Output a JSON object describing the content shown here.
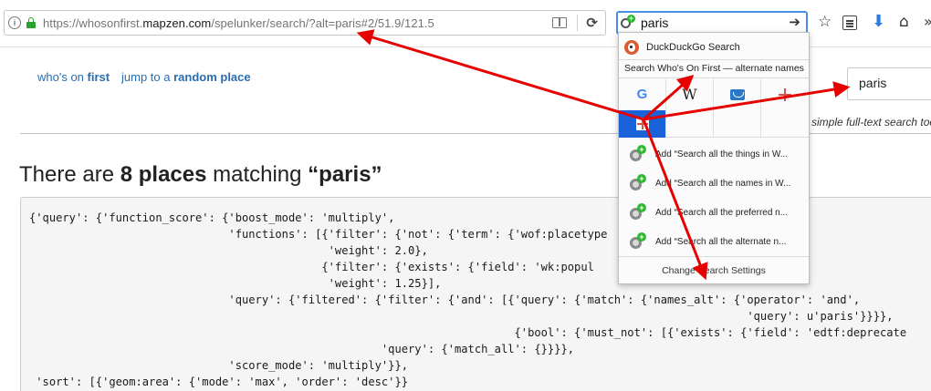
{
  "browser": {
    "url_prefix": "https://whosonfirst.",
    "url_host": "mapzen.com",
    "url_rest": "/spelunker/search/?alt=paris#2/51.9/121.5",
    "search_value": "paris",
    "info_icon": "info-icon",
    "lock_icon": "lock-icon",
    "reader_icon": "reader-view-icon",
    "reload_icon": "reload-icon",
    "search_go_icon": "arrow-right-icon",
    "toolbar_icons": [
      "star-icon",
      "clipboard-icon",
      "download-icon",
      "home-icon",
      "overflow-icon"
    ],
    "accent_color": "#4a90e2"
  },
  "search_popup": {
    "engine_top_label": "DuckDuckGo Search",
    "search_title_prefix": "Search ",
    "search_title_site": "Who's On First",
    "search_title_suffix": " — alternate names",
    "engines": [
      "G",
      "W"
    ],
    "engine_icons": [
      "google-icon",
      "wikipedia-icon",
      "book-icon",
      "compass-icon"
    ],
    "selected_engine_icon": "wof-icon",
    "add_items": [
      "Add “Search all the things in W...",
      "Add “Search all the names in W...",
      "Add “Search all the preferred n...",
      "Add “Search all the alternate n..."
    ],
    "footer": "Change Search Settings",
    "selected_color": "#1a62d8"
  },
  "page": {
    "brand_prefix": "who's on ",
    "brand_bold": "first",
    "random_prefix": "jump to a ",
    "random_bold": "random place",
    "search_value": "paris",
    "hint": "simple full-text search tool",
    "heading_prefix": "There are ",
    "heading_count": "8 places",
    "heading_mid": " matching ",
    "heading_query": "“paris”",
    "link_color": "#2b6cb0"
  },
  "code_lines": [
    "{'query': {'function_score': {'boost_mode': 'multiply',",
    "                              'functions': [{'filter': {'not': {'term': {'wof:placetype",
    "                                             'weight': 2.0},",
    "                                            {'filter': {'exists': {'field': 'wk:popul",
    "                                             'weight': 1.25}],",
    "                              'query': {'filtered': {'filter': {'and': [{'query': {'match': {'names_alt': {'operator': 'and',",
    "                                                                                                            'query': u'paris'}}}},",
    "                                                                         {'bool': {'must_not': [{'exists': {'field': 'edtf:deprecate",
    "                                                     'query': {'match_all': {}}}},",
    "                              'score_mode': 'multiply'}},",
    " 'sort': [{'geom:area': {'mode': 'max', 'order': 'desc'}}"
  ],
  "annotation_color": "#e60000"
}
